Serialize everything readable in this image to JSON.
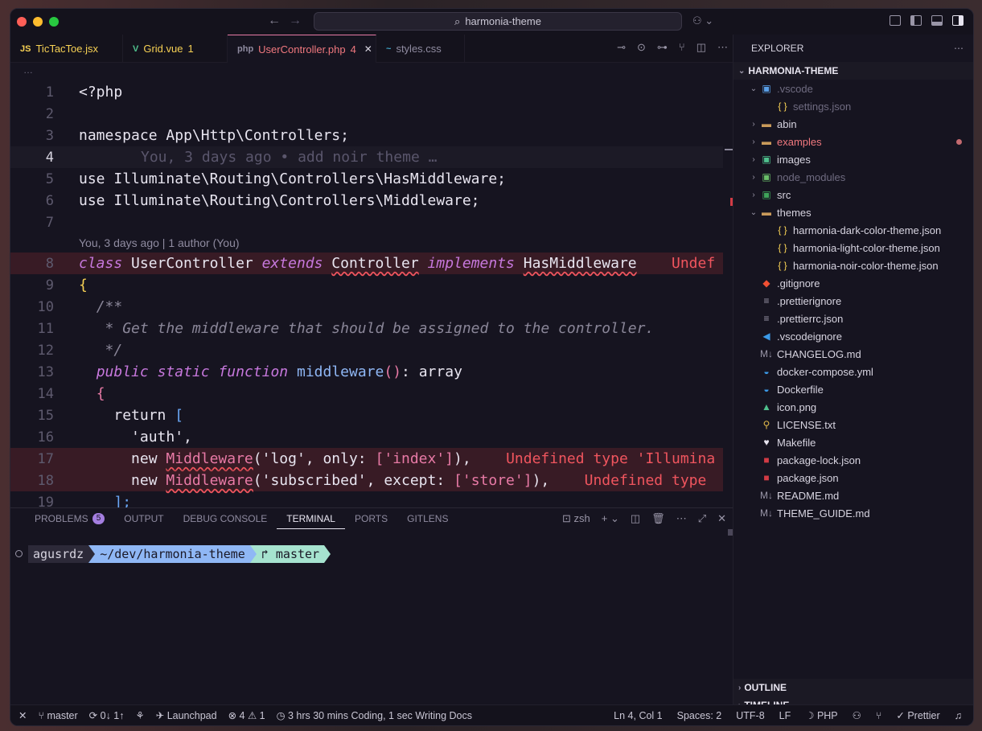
{
  "window": {
    "search_text": "harmonia-theme"
  },
  "tabs": [
    {
      "icon": "JS",
      "label": "TicTacToe.jsx",
      "badge": "",
      "color": "#f7d154",
      "active": false
    },
    {
      "icon": "V",
      "label": "Grid.vue",
      "badge": "1",
      "color": "#f7d154",
      "active": false
    },
    {
      "icon": "php",
      "label": "UserController.php",
      "badge": "4",
      "color": "#f0787e",
      "active": true
    },
    {
      "icon": "~",
      "label": "styles.css",
      "badge": "",
      "color": "#8f8ba0",
      "active": false
    }
  ],
  "breadcrumb": "…",
  "code": {
    "codelens": "You, 3 days ago | 1 author (You)",
    "ghost": "You, 3 days ago • add noir theme …",
    "line_numbers": [
      "1",
      "2",
      "3",
      "4",
      "5",
      "6",
      "7",
      "8",
      "9",
      "10",
      "11",
      "12",
      "13",
      "14",
      "15",
      "16",
      "17",
      "18",
      "19"
    ],
    "l1": "<?php",
    "l3_kw": "namespace",
    "l3_ns": "App\\Http\\Controllers;",
    "l5_kw": "use",
    "l5_ns": "Illuminate\\Routing\\Controllers\\HasMiddleware;",
    "l6_kw": "use",
    "l6_ns": "Illuminate\\Routing\\Controllers\\Middleware;",
    "l8_class": "class",
    "l8_name": "UserController",
    "l8_extends": "extends",
    "l8_parent": "Controller",
    "l8_impl": "implements",
    "l8_iface": "HasMiddleware",
    "l8_err": "Undef",
    "l9": "{",
    "l10": "/**",
    "l11": "* Get the middleware that should be assigned to the controller.",
    "l12": "*/",
    "l13_public": "public",
    "l13_static": "static",
    "l13_function": "function",
    "l13_name": "middleware",
    "l13_paren": "()",
    "l13_ret": ": array",
    "l14": "{",
    "l15_return": "return",
    "l15_brk": "[",
    "l16": "'auth',",
    "l17_new": "new",
    "l17_cls": "Middleware",
    "l17_args1": "('log', only: ",
    "l17_arr": "['index']",
    "l17_end": "),",
    "l17_err": "Undefined type 'Illumina",
    "l18_new": "new",
    "l18_cls": "Middleware",
    "l18_args1": "('subscribed', except: ",
    "l18_arr": "['store']",
    "l18_end": "),",
    "l18_err": "Undefined type",
    "l19": "];"
  },
  "panel": {
    "tabs": [
      {
        "label": "PROBLEMS",
        "badge": "5",
        "active": false
      },
      {
        "label": "OUTPUT",
        "badge": "",
        "active": false
      },
      {
        "label": "DEBUG CONSOLE",
        "badge": "",
        "active": false
      },
      {
        "label": "TERMINAL",
        "badge": "",
        "active": true
      },
      {
        "label": "PORTS",
        "badge": "",
        "active": false
      },
      {
        "label": "GITLENS",
        "badge": "",
        "active": false
      }
    ],
    "shell": "zsh",
    "prompt_user": "agusrdz",
    "prompt_path": "~/dev/harmonia-theme",
    "prompt_branch": "↱ master"
  },
  "sidebar": {
    "title": "EXPLORER",
    "project": "HARMONIA-THEME",
    "items": [
      {
        "depth": 1,
        "chev": "⌄",
        "icon": "▣",
        "icon_color": "#5aa0e8",
        "label": ".vscode",
        "style": "dim",
        "dot": false
      },
      {
        "depth": 2,
        "chev": "",
        "icon": "{ }",
        "icon_color": "#f7d154",
        "label": "settings.json",
        "style": "dim",
        "dot": false
      },
      {
        "depth": 1,
        "chev": "›",
        "icon": "▬",
        "icon_color": "#c99a5a",
        "label": "abin",
        "style": "",
        "dot": false
      },
      {
        "depth": 1,
        "chev": "›",
        "icon": "▬",
        "icon_color": "#c99a5a",
        "label": "examples",
        "style": "red",
        "dot": true
      },
      {
        "depth": 1,
        "chev": "›",
        "icon": "▣",
        "icon_color": "#4fc08d",
        "label": "images",
        "style": "",
        "dot": false
      },
      {
        "depth": 1,
        "chev": "›",
        "icon": "▣",
        "icon_color": "#6abf69",
        "label": "node_modules",
        "style": "dim",
        "dot": false
      },
      {
        "depth": 1,
        "chev": "›",
        "icon": "▣",
        "icon_color": "#3fa55a",
        "label": "src",
        "style": "",
        "dot": false
      },
      {
        "depth": 1,
        "chev": "⌄",
        "icon": "▬",
        "icon_color": "#c99a5a",
        "label": "themes",
        "style": "",
        "dot": false
      },
      {
        "depth": 2,
        "chev": "",
        "icon": "{ }",
        "icon_color": "#f7d154",
        "label": "harmonia-dark-color-theme.json",
        "style": "",
        "dot": false
      },
      {
        "depth": 2,
        "chev": "",
        "icon": "{ }",
        "icon_color": "#f7d154",
        "label": "harmonia-light-color-theme.json",
        "style": "",
        "dot": false
      },
      {
        "depth": 2,
        "chev": "",
        "icon": "{ }",
        "icon_color": "#f7d154",
        "label": "harmonia-noir-color-theme.json",
        "style": "",
        "dot": false
      },
      {
        "depth": 1,
        "chev": "",
        "icon": "◆",
        "icon_color": "#f05033",
        "label": ".gitignore",
        "style": "",
        "dot": false
      },
      {
        "depth": 1,
        "chev": "",
        "icon": "≡",
        "icon_color": "#9a96a8",
        "label": ".prettierignore",
        "style": "",
        "dot": false
      },
      {
        "depth": 1,
        "chev": "",
        "icon": "≡",
        "icon_color": "#9a96a8",
        "label": ".prettierrc.json",
        "style": "",
        "dot": false
      },
      {
        "depth": 1,
        "chev": "",
        "icon": "◀",
        "icon_color": "#3b9ae8",
        "label": ".vscodeignore",
        "style": "",
        "dot": false
      },
      {
        "depth": 1,
        "chev": "",
        "icon": "M↓",
        "icon_color": "#9a96a8",
        "label": "CHANGELOG.md",
        "style": "",
        "dot": false
      },
      {
        "depth": 1,
        "chev": "",
        "icon": "◒",
        "icon_color": "#3b9ae8",
        "label": "docker-compose.yml",
        "style": "",
        "dot": false
      },
      {
        "depth": 1,
        "chev": "",
        "icon": "◒",
        "icon_color": "#3b9ae8",
        "label": "Dockerfile",
        "style": "",
        "dot": false
      },
      {
        "depth": 1,
        "chev": "",
        "icon": "▲",
        "icon_color": "#4fc08d",
        "label": "icon.png",
        "style": "",
        "dot": false
      },
      {
        "depth": 1,
        "chev": "",
        "icon": "⚲",
        "icon_color": "#e0b84a",
        "label": "LICENSE.txt",
        "style": "",
        "dot": false
      },
      {
        "depth": 1,
        "chev": "",
        "icon": "♥",
        "icon_color": "#e8e5f0",
        "label": "Makefile",
        "style": "",
        "dot": false
      },
      {
        "depth": 1,
        "chev": "",
        "icon": "■",
        "icon_color": "#d13b45",
        "label": "package-lock.json",
        "style": "",
        "dot": false
      },
      {
        "depth": 1,
        "chev": "",
        "icon": "■",
        "icon_color": "#d13b45",
        "label": "package.json",
        "style": "",
        "dot": false
      },
      {
        "depth": 1,
        "chev": "",
        "icon": "M↓",
        "icon_color": "#9a96a8",
        "label": "README.md",
        "style": "",
        "dot": false
      },
      {
        "depth": 1,
        "chev": "",
        "icon": "M↓",
        "icon_color": "#9a96a8",
        "label": "THEME_GUIDE.md",
        "style": "",
        "dot": false
      }
    ],
    "outline": "OUTLINE",
    "timeline": "TIMELINE"
  },
  "status": {
    "remote": "✕",
    "branch": "master",
    "sync": "0↓ 1↑",
    "launchpad": "Launchpad",
    "errors": "4",
    "warnings": "1",
    "wakatime": "3 hrs 30 mins Coding, 1 sec Writing Docs",
    "position": "Ln 4, Col 1",
    "spaces": "Spaces: 2",
    "encoding": "UTF-8",
    "eol": "LF",
    "language": "PHP",
    "prettier": "✓ Prettier"
  }
}
